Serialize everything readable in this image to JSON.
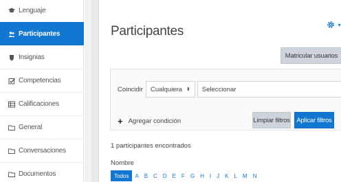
{
  "sidebar": {
    "items": [
      {
        "label": "Lenguaje",
        "icon": "graduation-cap-icon",
        "active": false
      },
      {
        "label": "Participantes",
        "icon": "users-icon",
        "active": true
      },
      {
        "label": "Insignias",
        "icon": "shield-icon",
        "active": false
      },
      {
        "label": "Competencias",
        "icon": "checkbox-icon",
        "active": false
      },
      {
        "label": "Calificaciones",
        "icon": "table-icon",
        "active": false
      },
      {
        "label": "General",
        "icon": "folder-icon",
        "active": false
      },
      {
        "label": "Conversaciones",
        "icon": "folder-icon",
        "active": false
      },
      {
        "label": "Documentos",
        "icon": "folder-icon",
        "active": false
      }
    ]
  },
  "main": {
    "title": "Participantes",
    "settings_icon": "gear-icon",
    "enrol_button": "Matricular usuarios",
    "filter": {
      "match_label": "Coincidir",
      "match_value": "Cualquiera",
      "select_placeholder": "Seleccionar",
      "add_condition": "Agregar condición",
      "clear_button": "Limpiar filtros",
      "apply_button": "Aplicar filtros"
    },
    "count_text": "1 participantes encontrados",
    "name_label": "Nombre",
    "letters": [
      "Todos",
      "A",
      "B",
      "C",
      "D",
      "E",
      "F",
      "G",
      "H",
      "I",
      "J",
      "K",
      "L",
      "M",
      "N"
    ]
  },
  "colors": {
    "accent": "#1177d1",
    "secondary_button": "#ced4da"
  }
}
